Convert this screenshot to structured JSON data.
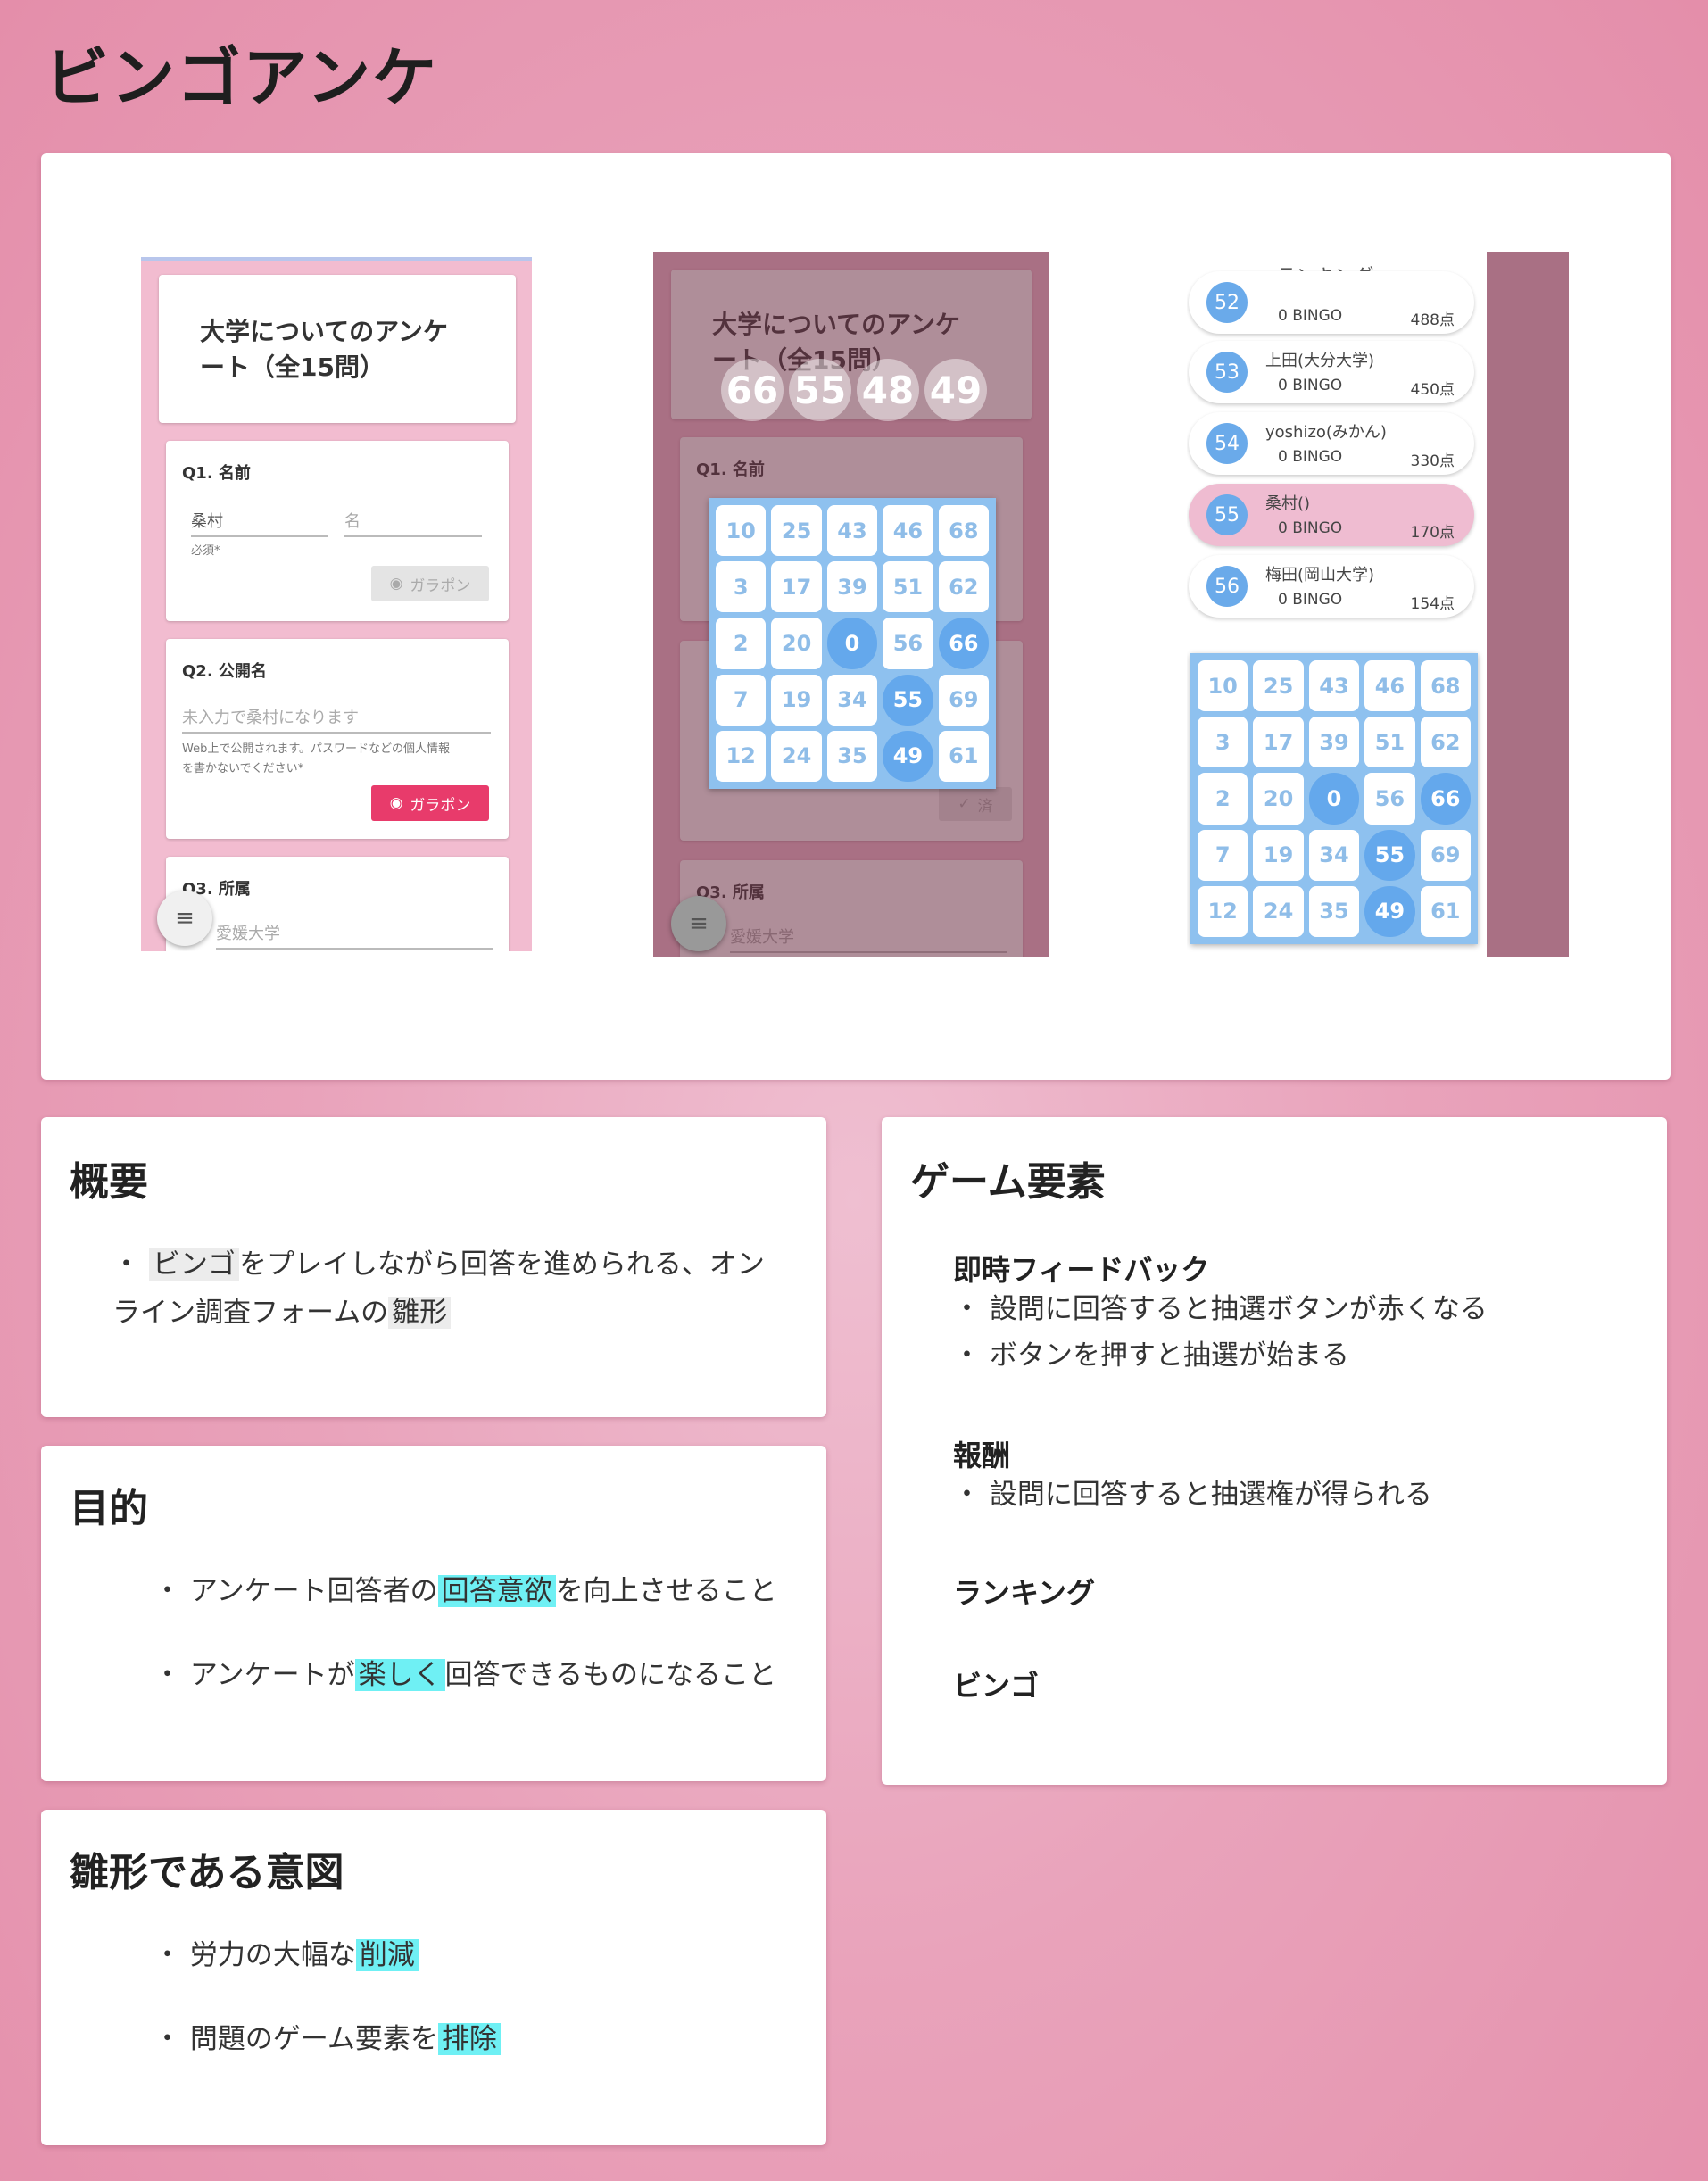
{
  "page": {
    "title": "ビンゴアンケ"
  },
  "screens": {
    "form_title": "大学についてのアンケート（全15問）",
    "form_title_line1": "大学についてのアンケ",
    "form_title_line2": "ート（全15問）",
    "q1": {
      "label": "Q1. 名前",
      "last_name_value": "桑村",
      "first_name_placeholder": "名",
      "required": "必須*",
      "button": "ガラポン"
    },
    "q2": {
      "label": "Q2. 公開名",
      "placeholder": "未入力で桑村になります",
      "help_line1": "Web上で公開されます。パスワードなどの個人情報",
      "help_line2": "を書かないでください*",
      "button": "ガラポン"
    },
    "q3": {
      "label": "Q3. 所属",
      "value": "愛媛大学"
    },
    "done_button": "済",
    "drawn_numbers": [
      "66",
      "55",
      "48",
      "49"
    ],
    "bingo_card": [
      [
        "10",
        "25",
        "43",
        "46",
        "68"
      ],
      [
        "3",
        "17",
        "39",
        "51",
        "62"
      ],
      [
        "2",
        "20",
        "0",
        "56",
        "66"
      ],
      [
        "7",
        "19",
        "34",
        "55",
        "69"
      ],
      [
        "12",
        "24",
        "35",
        "49",
        "61"
      ]
    ],
    "bingo_hits": [
      "0",
      "66",
      "55",
      "49"
    ],
    "ranking": {
      "title": "ランキング",
      "items": [
        {
          "rank": "52",
          "name": "",
          "bingo": "0 BINGO",
          "points": "488点",
          "me": false
        },
        {
          "rank": "53",
          "name": "上田(大分大学)",
          "bingo": "0 BINGO",
          "points": "450点",
          "me": false
        },
        {
          "rank": "54",
          "name": "yoshizo(みかん)",
          "bingo": "0 BINGO",
          "points": "330点",
          "me": false
        },
        {
          "rank": "55",
          "name": "桑村()",
          "bingo": "0 BINGO",
          "points": "170点",
          "me": true
        },
        {
          "rank": "56",
          "name": "梅田(岡山大学)",
          "bingo": "0 BINGO",
          "points": "154点",
          "me": false
        }
      ]
    }
  },
  "overview": {
    "title": "概要",
    "b1_pre": "・",
    "b1_hl1": "ビンゴ",
    "b1_mid": "をプレイしながら回答を進められる、オン",
    "b1_line2": "ライン調査フォームの",
    "b1_hl2": "雛形"
  },
  "purpose": {
    "title": "目的",
    "b1_pre": "・ アンケート回答者の",
    "b1_hl": "回答意欲",
    "b1_post": "を向上させること",
    "b2_pre": "・ アンケートが",
    "b2_hl": "楽しく",
    "b2_post": "回答できるものになること"
  },
  "intent": {
    "title": "雛形である意図",
    "b1_pre": "・ 労力の大幅な",
    "b1_hl": "削減",
    "b2_pre": "・ 問題のゲーム要素を",
    "b2_hl": "排除"
  },
  "game": {
    "title": "ゲーム要素",
    "feedback_head": "即時フィードバック",
    "feedback_b1": "・ 設問に回答すると抽選ボタンが赤くなる",
    "feedback_b2": "・ ボタンを押すと抽選が始まる",
    "reward_head": "報酬",
    "reward_b1": "・ 設問に回答すると抽選権が得られる",
    "ranking_head": "ランキング",
    "bingo_head": "ビンゴ"
  },
  "colors": {
    "accent_pink": "#e83b6b",
    "bingo_blue": "#64a8ec",
    "highlight_cyan": "#6ff0f4"
  }
}
